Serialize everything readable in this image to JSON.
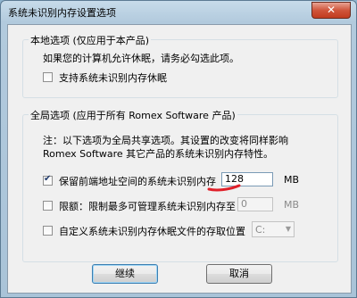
{
  "window": {
    "title": "系统未识别内存设置选项",
    "close_glyph": "✕"
  },
  "local": {
    "legend": "本地选项 (仅应用于本产品)",
    "description": "如果您的计算机允许休眠，请务必勾选此项。",
    "hibernate_label": "支持系统未识别内存休眠",
    "hibernate_checked": false
  },
  "global": {
    "legend": "全局选项 (应用于所有 Romex Software 产品)",
    "note_line1": "注：以下选项为全局共享选项。其设置的改变将同样影响",
    "note_line2": "Romex Software 其它产品的系统未识别内存特性。",
    "reserve_label": "保留前端地址空间的系统未识别内存",
    "reserve_checked": true,
    "reserve_value": "128",
    "reserve_unit": "MB",
    "limit_label": "限额：限制最多可管理系统未识别内存至",
    "limit_checked": false,
    "limit_value": "0",
    "limit_unit": "MB",
    "custom_label": "自定义系统未识别内存休眠文件的存取位置",
    "custom_checked": false,
    "drive_value": "C:"
  },
  "buttons": {
    "ok": "继续",
    "cancel": "取消"
  }
}
